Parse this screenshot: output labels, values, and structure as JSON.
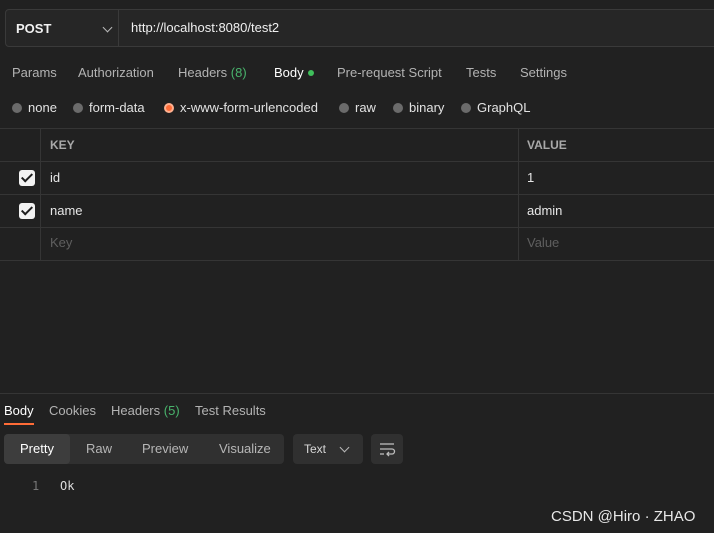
{
  "request": {
    "method": "POST",
    "url": "http://localhost:8080/test2"
  },
  "request_tabs": [
    {
      "label": "Params"
    },
    {
      "label": "Authorization"
    },
    {
      "label": "Headers",
      "count": "(8)"
    },
    {
      "label": "Body",
      "active": true
    },
    {
      "label": "Pre-request Script"
    },
    {
      "label": "Tests"
    },
    {
      "label": "Settings"
    }
  ],
  "body_types": [
    {
      "label": "none"
    },
    {
      "label": "form-data"
    },
    {
      "label": "x-www-form-urlencoded",
      "selected": true
    },
    {
      "label": "raw"
    },
    {
      "label": "binary"
    },
    {
      "label": "GraphQL"
    }
  ],
  "params_table": {
    "headers": {
      "key": "KEY",
      "value": "VALUE"
    },
    "rows": [
      {
        "checked": true,
        "key": "id",
        "value": "1"
      },
      {
        "checked": true,
        "key": "name",
        "value": "admin"
      }
    ],
    "placeholder": {
      "key": "Key",
      "value": "Value"
    }
  },
  "response_tabs": [
    {
      "label": "Body",
      "active": true
    },
    {
      "label": "Cookies"
    },
    {
      "label": "Headers",
      "count": "(5)"
    },
    {
      "label": "Test Results"
    }
  ],
  "view_modes": [
    {
      "label": "Pretty",
      "active": true
    },
    {
      "label": "Raw"
    },
    {
      "label": "Preview"
    },
    {
      "label": "Visualize"
    }
  ],
  "format_select": "Text",
  "response_body": {
    "line_number": "1",
    "content": "Ok"
  },
  "watermark": "CSDN @Hiro · ZHAO",
  "colors": {
    "accent": "#ff6c37",
    "count_green": "#49b36c",
    "background": "#212121"
  },
  "icons": {
    "method_dropdown": "chevron-down-icon",
    "format_dropdown": "chevron-down-icon",
    "wrap": "wrap-lines-icon",
    "checkbox": "check-icon"
  }
}
